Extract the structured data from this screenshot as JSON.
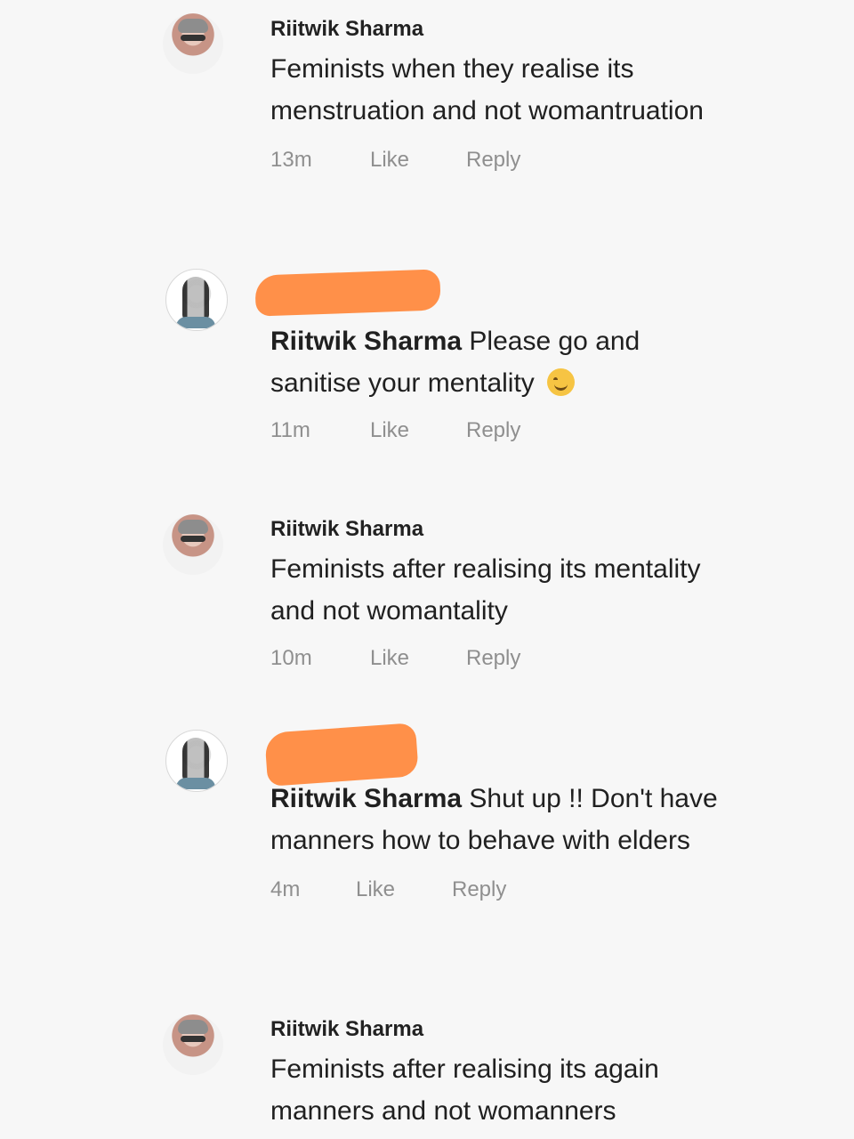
{
  "comments": [
    {
      "author": "Riitwik Sharma",
      "text": "Feminists when they realise its menstruation and not womantruation",
      "time": "13m",
      "like": "Like",
      "reply": "Reply"
    },
    {
      "mention": "Riitwik Sharma",
      "text": "Please go and sanitise your mentality",
      "time": "11m",
      "like": "Like",
      "reply": "Reply",
      "emoji": "smiling-face-icon"
    },
    {
      "author": "Riitwik Sharma",
      "text": "Feminists after realising its mentality and not womantality",
      "time": "10m",
      "like": "Like",
      "reply": "Reply"
    },
    {
      "mention": "Riitwik Sharma",
      "text": "Shut up !! Don't have manners how to behave with elders",
      "time": "4m",
      "like": "Like",
      "reply": "Reply"
    },
    {
      "author": "Riitwik Sharma",
      "text": "Feminists after realising its again manners and not womanners"
    }
  ],
  "colors": {
    "redaction": "#ff8b42",
    "background": "#f7f7f7",
    "meta": "#8f8f8f"
  }
}
